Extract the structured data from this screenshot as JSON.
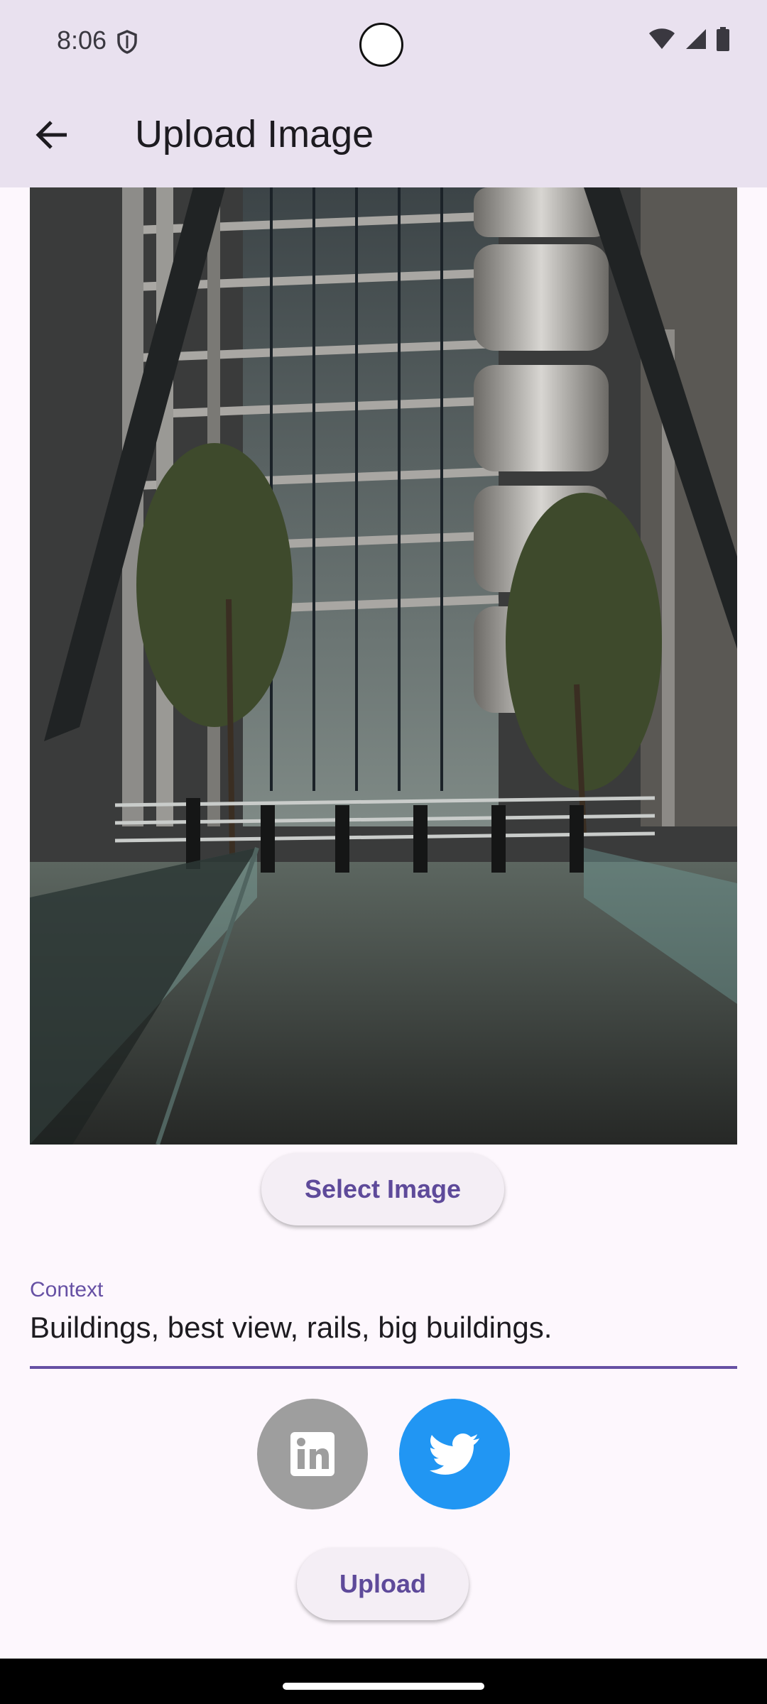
{
  "status_bar": {
    "time": "8:06"
  },
  "app_bar": {
    "title": "Upload Image"
  },
  "actions": {
    "select_image_label": "Select Image",
    "upload_label": "Upload"
  },
  "context_field": {
    "label": "Context",
    "value": "Buildings, best view, rails, big buildings."
  },
  "social_toggles": [
    {
      "icon": "linkedin-icon",
      "enabled": false,
      "color": "#9e9e9e"
    },
    {
      "icon": "twitter-icon",
      "enabled": true,
      "color": "#2196f3"
    }
  ],
  "colors": {
    "app_bar": "#e9e1ef",
    "background": "#fdf7fd",
    "accent": "#6650a4",
    "button_text": "#5e4a9a"
  }
}
